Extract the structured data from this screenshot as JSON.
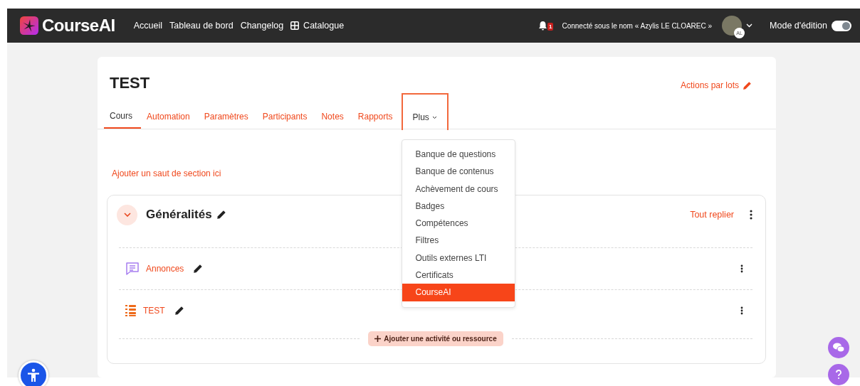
{
  "brand": {
    "name": "CourseAI"
  },
  "nav": [
    {
      "label": "Accueil",
      "kind": "link"
    },
    {
      "label": "Tableau de bord",
      "kind": "link"
    },
    {
      "label": "Changelog",
      "kind": "link"
    },
    {
      "label": "Catalogue",
      "kind": "grid"
    }
  ],
  "notifications": {
    "count": "1"
  },
  "user": {
    "text": "Connecté sous le nom « Azylis LE CLOAREC »",
    "initials": "AL"
  },
  "edit_mode": {
    "label": "Mode d'édition",
    "on": true
  },
  "course": {
    "title": "TEST",
    "bulk_actions": "Actions par lots"
  },
  "tabs": [
    {
      "label": "Cours",
      "selected": true,
      "kind": "tab"
    },
    {
      "label": "Automation",
      "selected": false,
      "kind": "tab"
    },
    {
      "label": "Paramètres",
      "selected": false,
      "kind": "tab"
    },
    {
      "label": "Participants",
      "selected": false,
      "kind": "tab"
    },
    {
      "label": "Notes",
      "selected": false,
      "kind": "tab"
    },
    {
      "label": "Rapports",
      "selected": false,
      "kind": "tab"
    },
    {
      "label": "Plus",
      "selected": false,
      "kind": "more",
      "expanded": true
    }
  ],
  "more_menu": [
    {
      "label": "Banque de questions",
      "selected": false
    },
    {
      "label": "Banque de contenus",
      "selected": false
    },
    {
      "label": "Achèvement de cours",
      "selected": false
    },
    {
      "label": "Badges",
      "selected": false
    },
    {
      "label": "Compétences",
      "selected": false
    },
    {
      "label": "Filtres",
      "selected": false
    },
    {
      "label": "Outils externes LTI",
      "selected": false
    },
    {
      "label": "Certificats",
      "selected": false
    },
    {
      "label": "CourseAI",
      "selected": true
    }
  ],
  "section_break": "Ajouter un saut de section ici",
  "section": {
    "title": "Généralités",
    "expanded": true,
    "collapse_all": "Tout replier",
    "activities": [
      {
        "name": "Annonces",
        "kind": "forum"
      },
      {
        "name": "TEST",
        "kind": "book"
      }
    ],
    "add_button": "Ajouter une activité ou ressource"
  }
}
